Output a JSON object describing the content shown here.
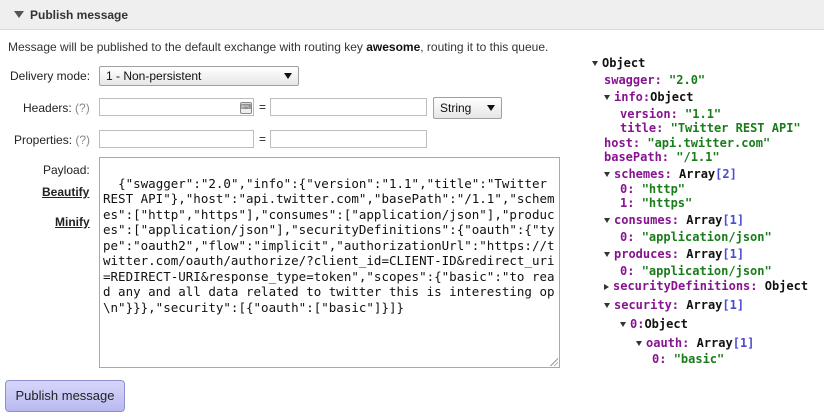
{
  "section": {
    "title": "Publish message"
  },
  "info": {
    "prefix": "Message will be published to the default exchange with routing key ",
    "key": "awesome",
    "suffix": ", routing it to this queue."
  },
  "delivery_mode": {
    "label": "Delivery mode:",
    "value": "1 - Non-persistent"
  },
  "headers": {
    "label": "Headers:",
    "help": "(?)",
    "eq": "=",
    "type": "String"
  },
  "properties": {
    "label": "Properties:",
    "help": "(?)",
    "eq": "="
  },
  "payload": {
    "label": "Payload:",
    "beautify": "Beautify",
    "minify": "Minify",
    "text": "{\"swagger\":\"2.0\",\"info\":{\"version\":\"1.1\",\"title\":\"Twitter REST API\"},\"host\":\"api.twitter.com\",\"basePath\":\"/1.1\",\"schemes\":[\"http\",\"https\"],\"consumes\":[\"application/json\"],\"produces\":[\"application/json\"],\"securityDefinitions\":{\"oauth\":{\"type\":\"oauth2\",\"flow\":\"implicit\",\"authorizationUrl\":\"https://twitter.com/oauth/authorize/?client_id=CLIENT-ID&redirect_uri=REDIRECT-URI&response_type=token\",\"scopes\":{\"basic\":\"to read any and all data related to twitter this is interesting op\\n\"}}},\"security\":[{\"oauth\":[\"basic\"]}]}"
  },
  "publish_button": "Publish message",
  "tree": {
    "root": "Object",
    "rows": [
      {
        "key": "swagger:",
        "value": "\"2.0\""
      },
      {
        "key": "info:",
        "value": "Object"
      },
      {
        "key": "version:",
        "value": "\"1.1\""
      },
      {
        "key": "title:",
        "value": "\"Twitter REST API\""
      },
      {
        "key": "host:",
        "value": "\"api.twitter.com\""
      },
      {
        "key": "basePath:",
        "value": "\"/1.1\""
      },
      {
        "key": "schemes:",
        "value": "Array",
        "count": "[2]"
      },
      {
        "key": "0:",
        "value": "\"http\""
      },
      {
        "key": "1:",
        "value": "\"https\""
      },
      {
        "key": "consumes:",
        "value": "Array",
        "count": "[1]"
      },
      {
        "key": "0:",
        "value": "\"application/json\""
      },
      {
        "key": "produces:",
        "value": "Array",
        "count": "[1]"
      },
      {
        "key": "0:",
        "value": "\"application/json\""
      },
      {
        "key": "securityDefinitions:",
        "value": "Object"
      },
      {
        "key": "security:",
        "value": "Array",
        "count": "[1]"
      },
      {
        "key": "0:",
        "value": "Object"
      },
      {
        "key": "oauth:",
        "value": "Array",
        "count": "[1]"
      },
      {
        "key": "0:",
        "value": "\"basic\""
      }
    ]
  }
}
